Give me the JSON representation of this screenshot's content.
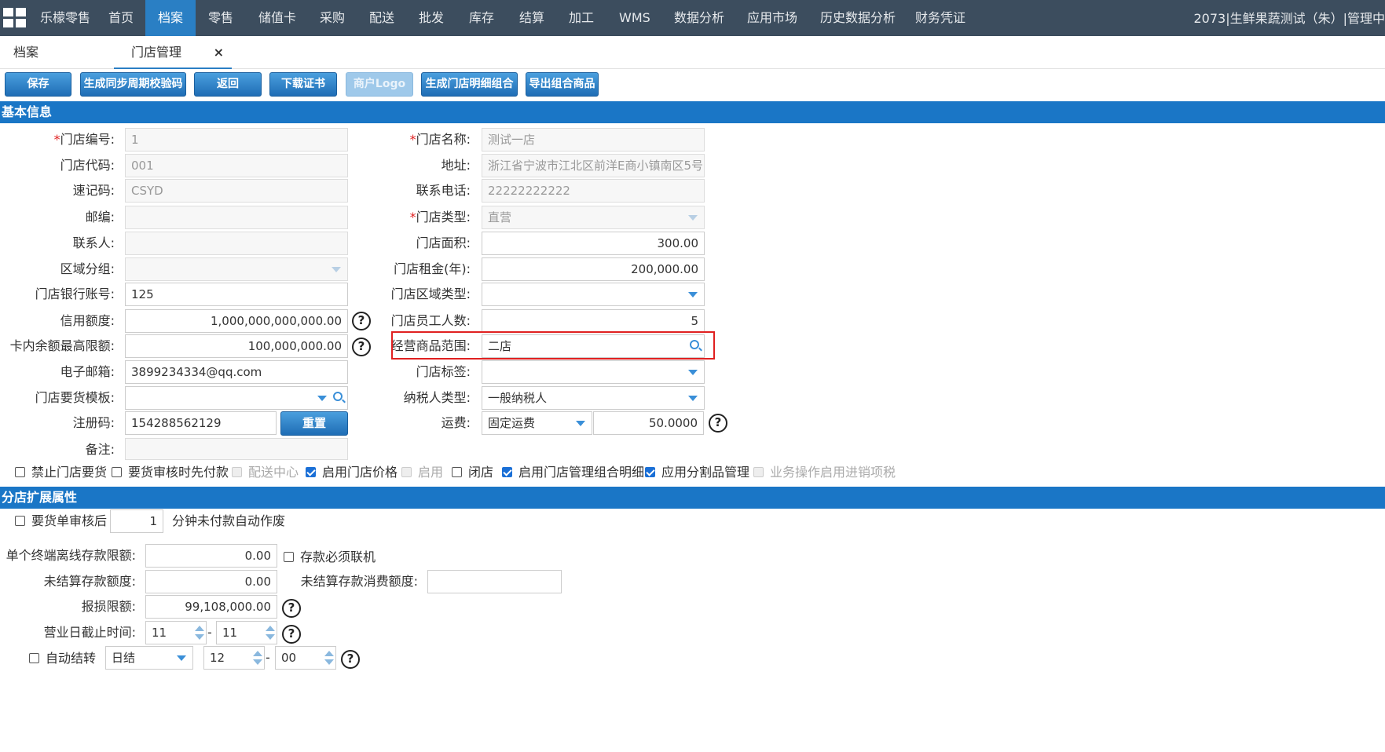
{
  "topnav": {
    "items": [
      "乐檬零售",
      "首页",
      "档案",
      "零售",
      "储值卡",
      "采购",
      "配送",
      "批发",
      "库存",
      "结算",
      "加工",
      "WMS",
      "数据分析",
      "应用市场",
      "历史数据分析",
      "财务凭证"
    ],
    "active_index": 2,
    "user_text": "2073|生鲜果蔬测试（朱）|管理中"
  },
  "tabs": [
    {
      "label": "档案"
    },
    {
      "label": "门店管理",
      "close": "×"
    }
  ],
  "toolbar": {
    "save": "保存",
    "gen_sync_code": "生成同步周期校验码",
    "back": "返回",
    "download_cert": "下载证书",
    "merchant_logo": "商户Logo",
    "gen_store_detail": "生成门店明细组合",
    "export_combo": "导出组合商品"
  },
  "sections": {
    "basic": "基本信息",
    "ext": "分店扩展属性"
  },
  "basic": {
    "store_no_label": "门店编号:",
    "store_no": "1",
    "store_code_label": "门店代码:",
    "store_code": "001",
    "quick_code_label": "速记码:",
    "quick_code": "CSYD",
    "postcode_label": "邮编:",
    "postcode": "",
    "contact_label": "联系人:",
    "contact": "",
    "region_group_label": "区域分组:",
    "region_group": "",
    "bank_account_label": "门店银行账号:",
    "bank_account": "125",
    "credit_label": "信用额度:",
    "credit": "1,000,000,000,000.00",
    "card_max_label": "卡内余额最高限额:",
    "card_max": "100,000,000.00",
    "email_label": "电子邮箱:",
    "email": "3899234334@qq.com",
    "order_template_label": "门店要货模板:",
    "order_template": "",
    "reg_code_label": "注册码:",
    "reg_code": "154288562129",
    "reset": "重置",
    "remark_label": "备注:",
    "remark": "",
    "store_name_label": "门店名称:",
    "store_name": "测试一店",
    "address_label": "地址:",
    "address": "浙江省宁波市江北区前洋E商小镇南区5号",
    "phone_label": "联系电话:",
    "phone": "22222222222",
    "store_type_label": "门店类型:",
    "store_type": "直营",
    "area_label": "门店面积:",
    "area": "300.00",
    "rent_label": "门店租金(年):",
    "rent": "200,000.00",
    "region_type_label": "门店区域类型:",
    "region_type": "",
    "staff_label": "门店员工人数:",
    "staff": "5",
    "goods_scope_label": "经营商品范围:",
    "goods_scope": "二店",
    "store_tag_label": "门店标签:",
    "store_tag": "",
    "tax_type_label": "纳税人类型:",
    "tax_type": "一般纳税人",
    "freight_label": "运费:",
    "freight_type": "固定运费",
    "freight_value": "50.0000",
    "required_mark": "*",
    "help": "?"
  },
  "checks": [
    {
      "label": "禁止门店要货",
      "checked": false,
      "disabled": false
    },
    {
      "label": "要货审核时先付款",
      "checked": false,
      "disabled": false
    },
    {
      "label": "配送中心",
      "checked": false,
      "disabled": true
    },
    {
      "label": "启用门店价格",
      "checked": true,
      "disabled": false
    },
    {
      "label": "启用",
      "checked": false,
      "disabled": true
    },
    {
      "label": "闭店",
      "checked": false,
      "disabled": false
    },
    {
      "label": "启用门店管理组合明细",
      "checked": true,
      "disabled": false
    },
    {
      "label": "应用分割品管理",
      "checked": true,
      "disabled": false
    },
    {
      "label": "业务操作启用进销项税",
      "checked": false,
      "disabled": true
    }
  ],
  "ext": {
    "order_after_label": "要货单审核后",
    "order_after_minutes": "1",
    "order_after_suffix": "分钟未付款自动作废",
    "offline_limit_label": "单个终端离线存款限额:",
    "offline_limit": "0.00",
    "must_online_label": "存款必须联机",
    "unsettled_label": "未结算存款额度:",
    "unsettled": "0.00",
    "unsettled_consume_label": "未结算存款消费额度:",
    "unsettled_consume": "",
    "loss_limit_label": "报损限额:",
    "loss_limit": "99,108,000.00",
    "cutoff_label": "营业日截止时间:",
    "cutoff_h1": "11",
    "cutoff_h2": "11",
    "auto_carry_label": "自动结转",
    "auto_carry_mode": "日结",
    "carry_h": "12",
    "carry_m": "00",
    "dash": "-"
  }
}
